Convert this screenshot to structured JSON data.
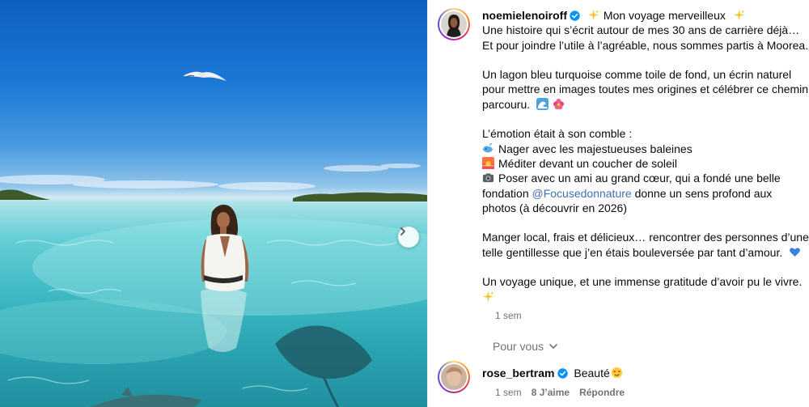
{
  "post": {
    "author": "noemielenoiroff",
    "title_text": "Mon voyage merveilleux",
    "caption_lines": {
      "l1": "Une histoire qui s’écrit autour de mes 30 ans de carrière déjà…",
      "l2": "Et pour joindre l’utile à l’agréable, nous sommes partis à Moorea.",
      "l3": "Un lagon bleu turquoise comme toile de fond, un écrin naturel",
      "l4": "pour mettre en images toutes mes origines et célébrer ce chemin",
      "l5": "parcouru.",
      "l6": "L’émotion était à son comble :",
      "l7": "Nager avec les majestueuses baleines",
      "l8": "Méditer devant un coucher de soleil",
      "l9": "Poser avec un ami au grand cœur, qui a fondé une belle",
      "l10a": "fondation",
      "l10_mention": "@Focusedonnature",
      "l10b": "donne un sens profond aux",
      "l11": "photos (à découvrir en 2026)",
      "l12": "Manger local, frais et délicieux… rencontrer des personnes d’une",
      "l13": "telle gentillesse que j’en étais bouleversée par tant d’amour.",
      "l14": "Un voyage unique, et une immense gratitude d’avoir pu le vivre."
    },
    "time": "1 sem"
  },
  "comments_section": {
    "label": "Pour vous"
  },
  "comment": {
    "author": "rose_bertram",
    "text": "Beauté",
    "time": "1 sem",
    "likes": "8 J’aime",
    "reply": "Répondre"
  },
  "icons": {
    "verified": "verified-badge-icon",
    "sparkles": "sparkles-icon",
    "wave": "wave-icon",
    "flower": "hibiscus-icon",
    "whale": "whale-icon",
    "sunset": "sunset-icon",
    "camera": "camera-icon",
    "heart": "blue-heart-icon",
    "heart_eyes": "heart-eyes-icon",
    "chevron": "chevron-down-icon",
    "next": "chevron-right-icon"
  },
  "colors": {
    "verified": "#0095f6",
    "mention": "#3f6fb5",
    "secondary_text": "#737373"
  }
}
